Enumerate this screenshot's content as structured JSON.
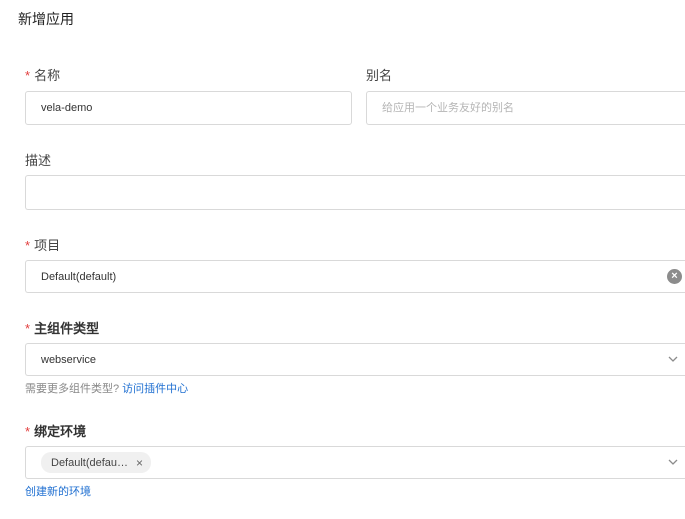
{
  "dialog": {
    "title": "新增应用"
  },
  "form": {
    "required_mark": "*",
    "name": {
      "label": "名称",
      "value": "vela-demo"
    },
    "alias": {
      "label": "别名",
      "placeholder": "给应用一个业务友好的别名"
    },
    "description": {
      "label": "描述",
      "value": ""
    },
    "project": {
      "label": "项目",
      "value": "Default(default)",
      "clear_icon": "×"
    },
    "component_type": {
      "label": "主组件类型",
      "value": "webservice",
      "hint": "需要更多组件类型?",
      "hint_link": "访问插件中心"
    },
    "environment": {
      "label": "绑定环境",
      "tag": "Default(defau…",
      "tag_close": "×",
      "create_link": "创建新的环境"
    }
  },
  "colors": {
    "required": "#e23d3d",
    "link": "#1f6fd1",
    "border": "#d9d9d9"
  }
}
